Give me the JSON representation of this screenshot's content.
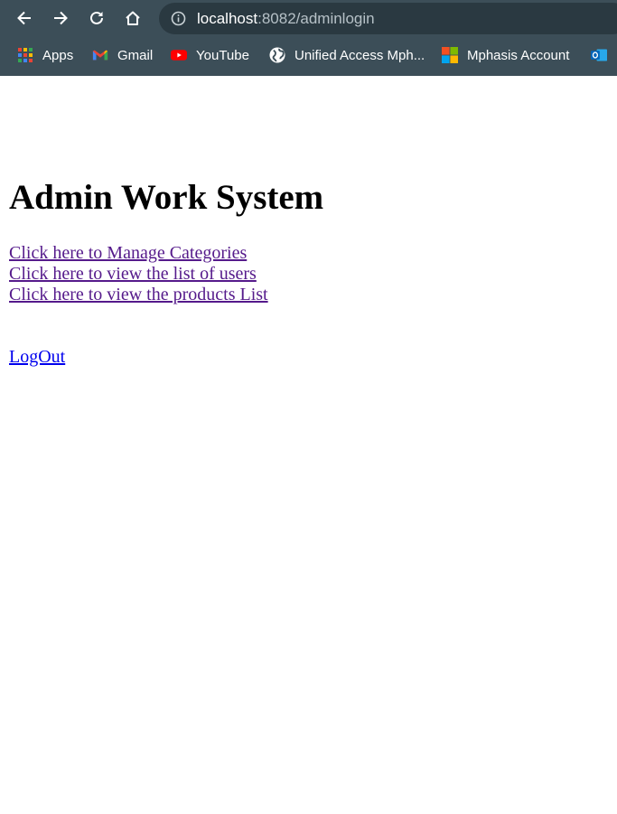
{
  "browser": {
    "url_host": "localhost",
    "url_path": ":8082/adminlogin",
    "bookmarks": [
      {
        "label": "Apps",
        "icon": "apps-grid-icon"
      },
      {
        "label": "Gmail",
        "icon": "gmail-icon"
      },
      {
        "label": "YouTube",
        "icon": "youtube-icon"
      },
      {
        "label": "Unified Access Mph...",
        "icon": "globe-icon"
      },
      {
        "label": "Mphasis Account",
        "icon": "microsoft-icon"
      }
    ],
    "colors": {
      "toolbar": "#3c4e58",
      "omnibox": "#2a3941"
    }
  },
  "page": {
    "title": "Admin Work System",
    "links": [
      "Click here to Manage Categories",
      "Click here to view the list of users",
      "Click here to view the products List"
    ],
    "logout": "LogOut"
  }
}
